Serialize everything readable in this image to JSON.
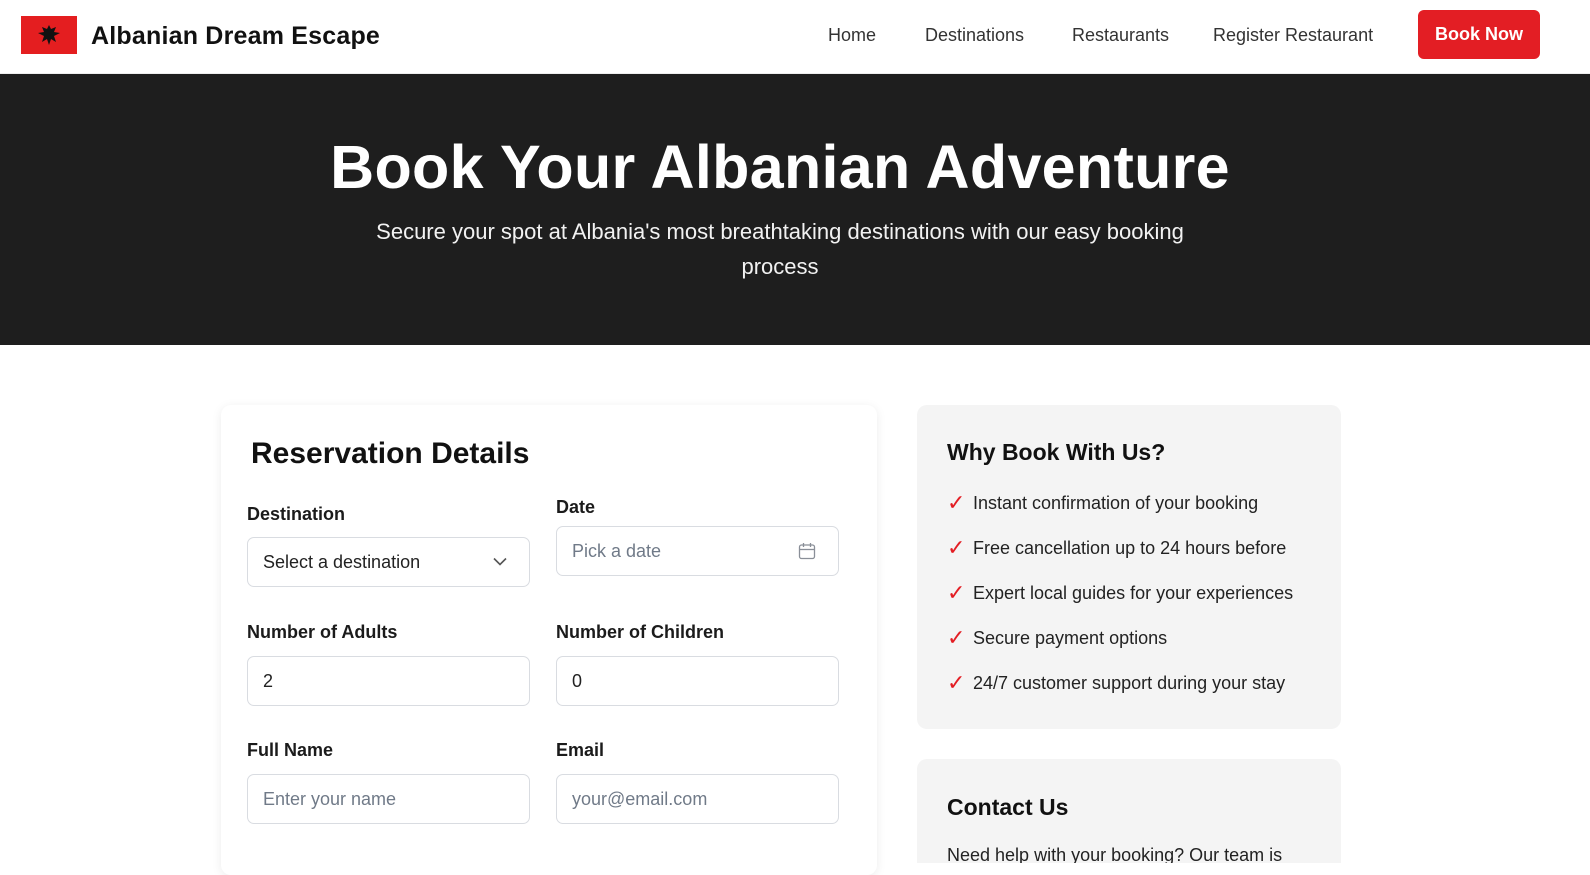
{
  "header": {
    "brand": "Albanian Dream Escape",
    "nav": [
      "Home",
      "Destinations",
      "Restaurants",
      "Register Restaurant"
    ],
    "cta": "Book Now",
    "accent": "#e31e24"
  },
  "hero": {
    "title": "Book Your Albanian Adventure",
    "subtitle": "Secure your spot at Albania's most breathtaking destinations with our easy booking process"
  },
  "form": {
    "title": "Reservation Details",
    "destination_label": "Destination",
    "destination_value": "Select a destination",
    "date_label": "Date",
    "date_placeholder": "Pick a date",
    "adults_label": "Number of Adults",
    "adults_value": "2",
    "children_label": "Number of Children",
    "children_value": "0",
    "name_label": "Full Name",
    "name_placeholder": "Enter your name",
    "email_label": "Email",
    "email_placeholder": "your@email.com"
  },
  "why": {
    "title": "Why Book With Us?",
    "items": [
      "Instant confirmation of your booking",
      "Free cancellation up to 24 hours before",
      "Expert local guides for your experiences",
      "Secure payment options",
      "24/7 customer support during your stay"
    ]
  },
  "contact": {
    "title": "Contact Us",
    "text": "Need help with your booking? Our team is"
  }
}
